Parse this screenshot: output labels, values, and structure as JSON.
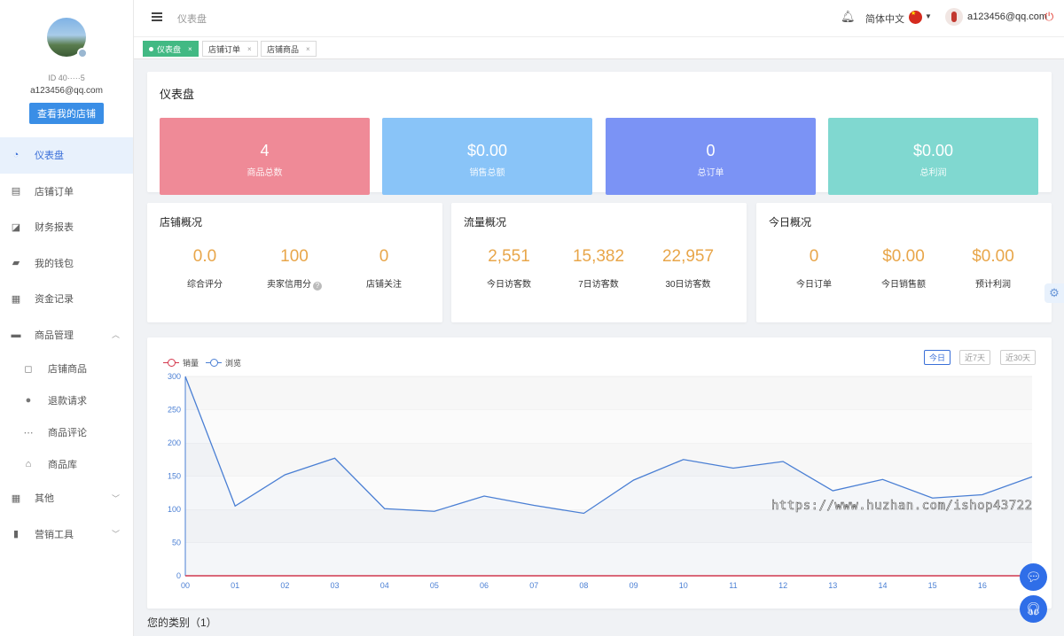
{
  "profile": {
    "nickname": "",
    "id_text": "ID 40·····5",
    "email": "a123456@qq.com",
    "shop_button": "查看我的店铺"
  },
  "sidebar": {
    "items": [
      {
        "label": "仪表盘",
        "icon": "dashboard-icon"
      },
      {
        "label": "店铺订单",
        "icon": "clipboard-icon"
      },
      {
        "label": "财务报表",
        "icon": "chart-icon"
      },
      {
        "label": "我的钱包",
        "icon": "wallet-icon"
      },
      {
        "label": "资金记录",
        "icon": "document-icon"
      },
      {
        "label": "商品管理",
        "icon": "briefcase-icon"
      }
    ],
    "sub_items": [
      {
        "label": "店铺商品",
        "icon": "bag-icon"
      },
      {
        "label": "退款请求",
        "icon": "alert-icon"
      },
      {
        "label": "商品评论",
        "icon": "comment-icon"
      },
      {
        "label": "商品库",
        "icon": "home-icon"
      }
    ],
    "tail_items": [
      {
        "label": "其他",
        "icon": "grid-icon"
      },
      {
        "label": "营销工具",
        "icon": "bar-chart-icon"
      }
    ]
  },
  "header": {
    "breadcrumb": "仪表盘",
    "language": "简体中文",
    "user_email": "a123456@qq.com"
  },
  "tabs": [
    {
      "label": "仪表盘"
    },
    {
      "label": "店铺订单"
    },
    {
      "label": "店铺商品"
    }
  ],
  "dashboard": {
    "title": "仪表盘",
    "stats": [
      {
        "value": "4",
        "label": "商品总数",
        "color": "#ef8a97"
      },
      {
        "value": "$0.00",
        "label": "销售总额",
        "color": "#89c4f8"
      },
      {
        "value": "0",
        "label": "总订单",
        "color": "#7b93f5"
      },
      {
        "value": "$0.00",
        "label": "总利润",
        "color": "#80d8d0"
      }
    ]
  },
  "shop_overview": {
    "title": "店铺概况",
    "cells": [
      {
        "value": "0.0",
        "label": "综合评分"
      },
      {
        "value": "100",
        "label": "卖家信用分"
      },
      {
        "value": "0",
        "label": "店铺关注"
      }
    ]
  },
  "traffic_overview": {
    "title": "流量概况",
    "cells": [
      {
        "value": "2,551",
        "label": "今日访客数"
      },
      {
        "value": "15,382",
        "label": "7日访客数"
      },
      {
        "value": "22,957",
        "label": "30日访客数"
      }
    ]
  },
  "today_overview": {
    "title": "今日概况",
    "cells": [
      {
        "value": "0",
        "label": "今日订单"
      },
      {
        "value": "$0.00",
        "label": "今日销售额"
      },
      {
        "value": "$0.00",
        "label": "预计利润"
      }
    ]
  },
  "chart_controls": {
    "ranges": [
      "今日",
      "近7天",
      "近30天"
    ],
    "active": "今日"
  },
  "chart_data": {
    "type": "line",
    "x": [
      "00",
      "01",
      "02",
      "03",
      "04",
      "05",
      "06",
      "07",
      "08",
      "09",
      "10",
      "11",
      "12",
      "13",
      "14",
      "15",
      "16",
      "17"
    ],
    "series": [
      {
        "name": "销量",
        "color": "#d4364b",
        "values": [
          0,
          0,
          0,
          0,
          0,
          0,
          0,
          0,
          0,
          0,
          0,
          0,
          0,
          0,
          0,
          0,
          0,
          0
        ]
      },
      {
        "name": "浏览",
        "color": "#4a7fd4",
        "values": [
          300,
          105,
          152,
          177,
          101,
          97,
          120,
          106,
          94,
          144,
          175,
          162,
          172,
          128,
          145,
          117,
          122,
          149
        ]
      }
    ],
    "ylim": [
      0,
      300
    ],
    "yticks": [
      0,
      50,
      100,
      150,
      200,
      250,
      300
    ],
    "xlabels": [
      "00",
      "01",
      "02",
      "03",
      "04",
      "05",
      "06",
      "07",
      "08",
      "09",
      "10",
      "11",
      "12",
      "13",
      "14",
      "15",
      "16"
    ]
  },
  "categories_title": "您的类别（1）",
  "watermark": "https://www.huzhan.com/ishop43722"
}
